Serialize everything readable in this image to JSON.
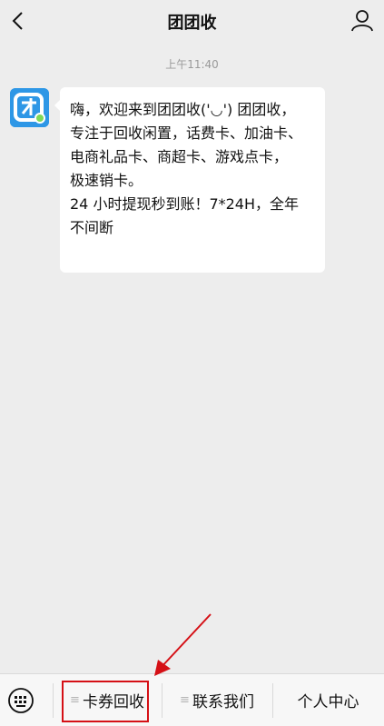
{
  "header": {
    "title": "团团收"
  },
  "timestamp": "上午11:40",
  "message": {
    "lines": [
      "嗨，欢迎来到团团收('◡') 团团收，",
      "专注于回收闲置，话费卡、加油卡、",
      "电商礼品卡、商超卡、游戏点卡，",
      "极速销卡。",
      "24 小时提现秒到账！7*24H，全年",
      "不间断"
    ]
  },
  "menu": {
    "items": [
      {
        "label": "卡券回收"
      },
      {
        "label": "联系我们"
      },
      {
        "label": "个人中心"
      }
    ]
  },
  "icons": {
    "back": "chevron-left-icon",
    "profile": "user-icon",
    "keyboard": "keyboard-icon",
    "menu_lines": "menu-lines-icon"
  },
  "colors": {
    "background": "#ededed",
    "avatar_bg": "#2e97e6",
    "avatar_dot": "#7ed957",
    "highlight": "#d51016"
  }
}
